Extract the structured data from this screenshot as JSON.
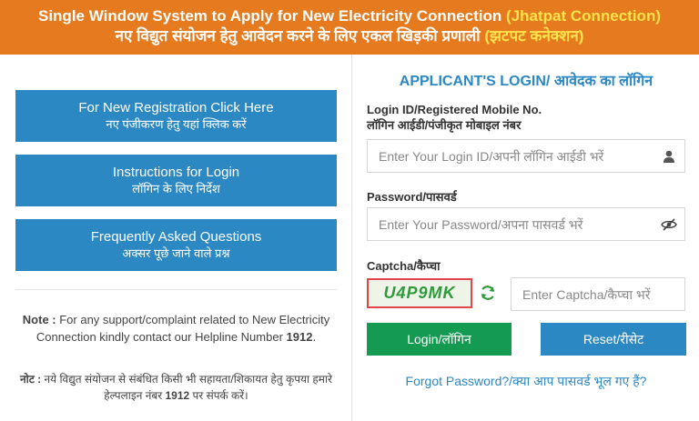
{
  "banner": {
    "line1_main": "Single Window System to Apply for New Electricity Connection",
    "line1_highlight": "(Jhatpat Connection)",
    "line2_main": "नए विद्युत संयोजन हेतु आवेदन करने के लिए एकल खिड़की प्रणाली",
    "line2_highlight": "(झटपट कनेक्शन)"
  },
  "nav": {
    "registration": {
      "en": "For New Registration Click Here",
      "hi": "नए पंजीकरण हेतु यहां क्लिक करें"
    },
    "instructions": {
      "en": "Instructions for Login",
      "hi": "लॉगिन के लिए निर्देश"
    },
    "faq": {
      "en": "Frequently Asked Questions",
      "hi": "अक्सर पूछे जाने वाले प्रश्न"
    }
  },
  "note": {
    "en_label": "Note :",
    "en_text": " For any support/complaint related to New Electricity Connection kindly contact our Helpline Number ",
    "helpline": "1912",
    "en_end": ".",
    "hi_label": "नोट :",
    "hi_text": " नये विद्युत संयोजन से संबंधित किसी भी सहायता/शिकायत हेतु कृपया हमारे हेल्पलाइन नंबर ",
    "hi_helpline": "1912",
    "hi_end": " पर संपर्क करें।"
  },
  "login": {
    "title": "APPLICANT'S LOGIN/ आवेदक का लॉगिन",
    "id_label_en": "Login ID/Registered Mobile No.",
    "id_label_hi": "लॉगिन आईडी/पंजीकृत मोबाइल नंबर",
    "id_placeholder": "Enter Your Login ID/अपनी लॉगिन आईडी भरें",
    "password_label": "Password/पासवर्ड",
    "password_placeholder": "Enter Your Password/अपना पासवर्ड भरें",
    "captcha_label": "Captcha/कैप्चा",
    "captcha_code": "U4P9MK",
    "captcha_placeholder": "Enter Captcha/कैप्चा भरें",
    "login_button": "Login/लॉगिन",
    "reset_button": "Reset/रीसेट",
    "forgot_link": "Forgot Password?/क्या आप पासवर्ड भूल गए हैं?"
  },
  "icons": {
    "user": "user-icon",
    "eye": "eye-slash-icon",
    "refresh": "refresh-icon"
  },
  "colors": {
    "banner_bg": "#e57a1e",
    "banner_highlight": "#ffe34d",
    "primary_blue": "#2c88c2",
    "login_green": "#159a51",
    "captcha_border": "#e2464b",
    "captcha_text": "#2e9a3c"
  }
}
